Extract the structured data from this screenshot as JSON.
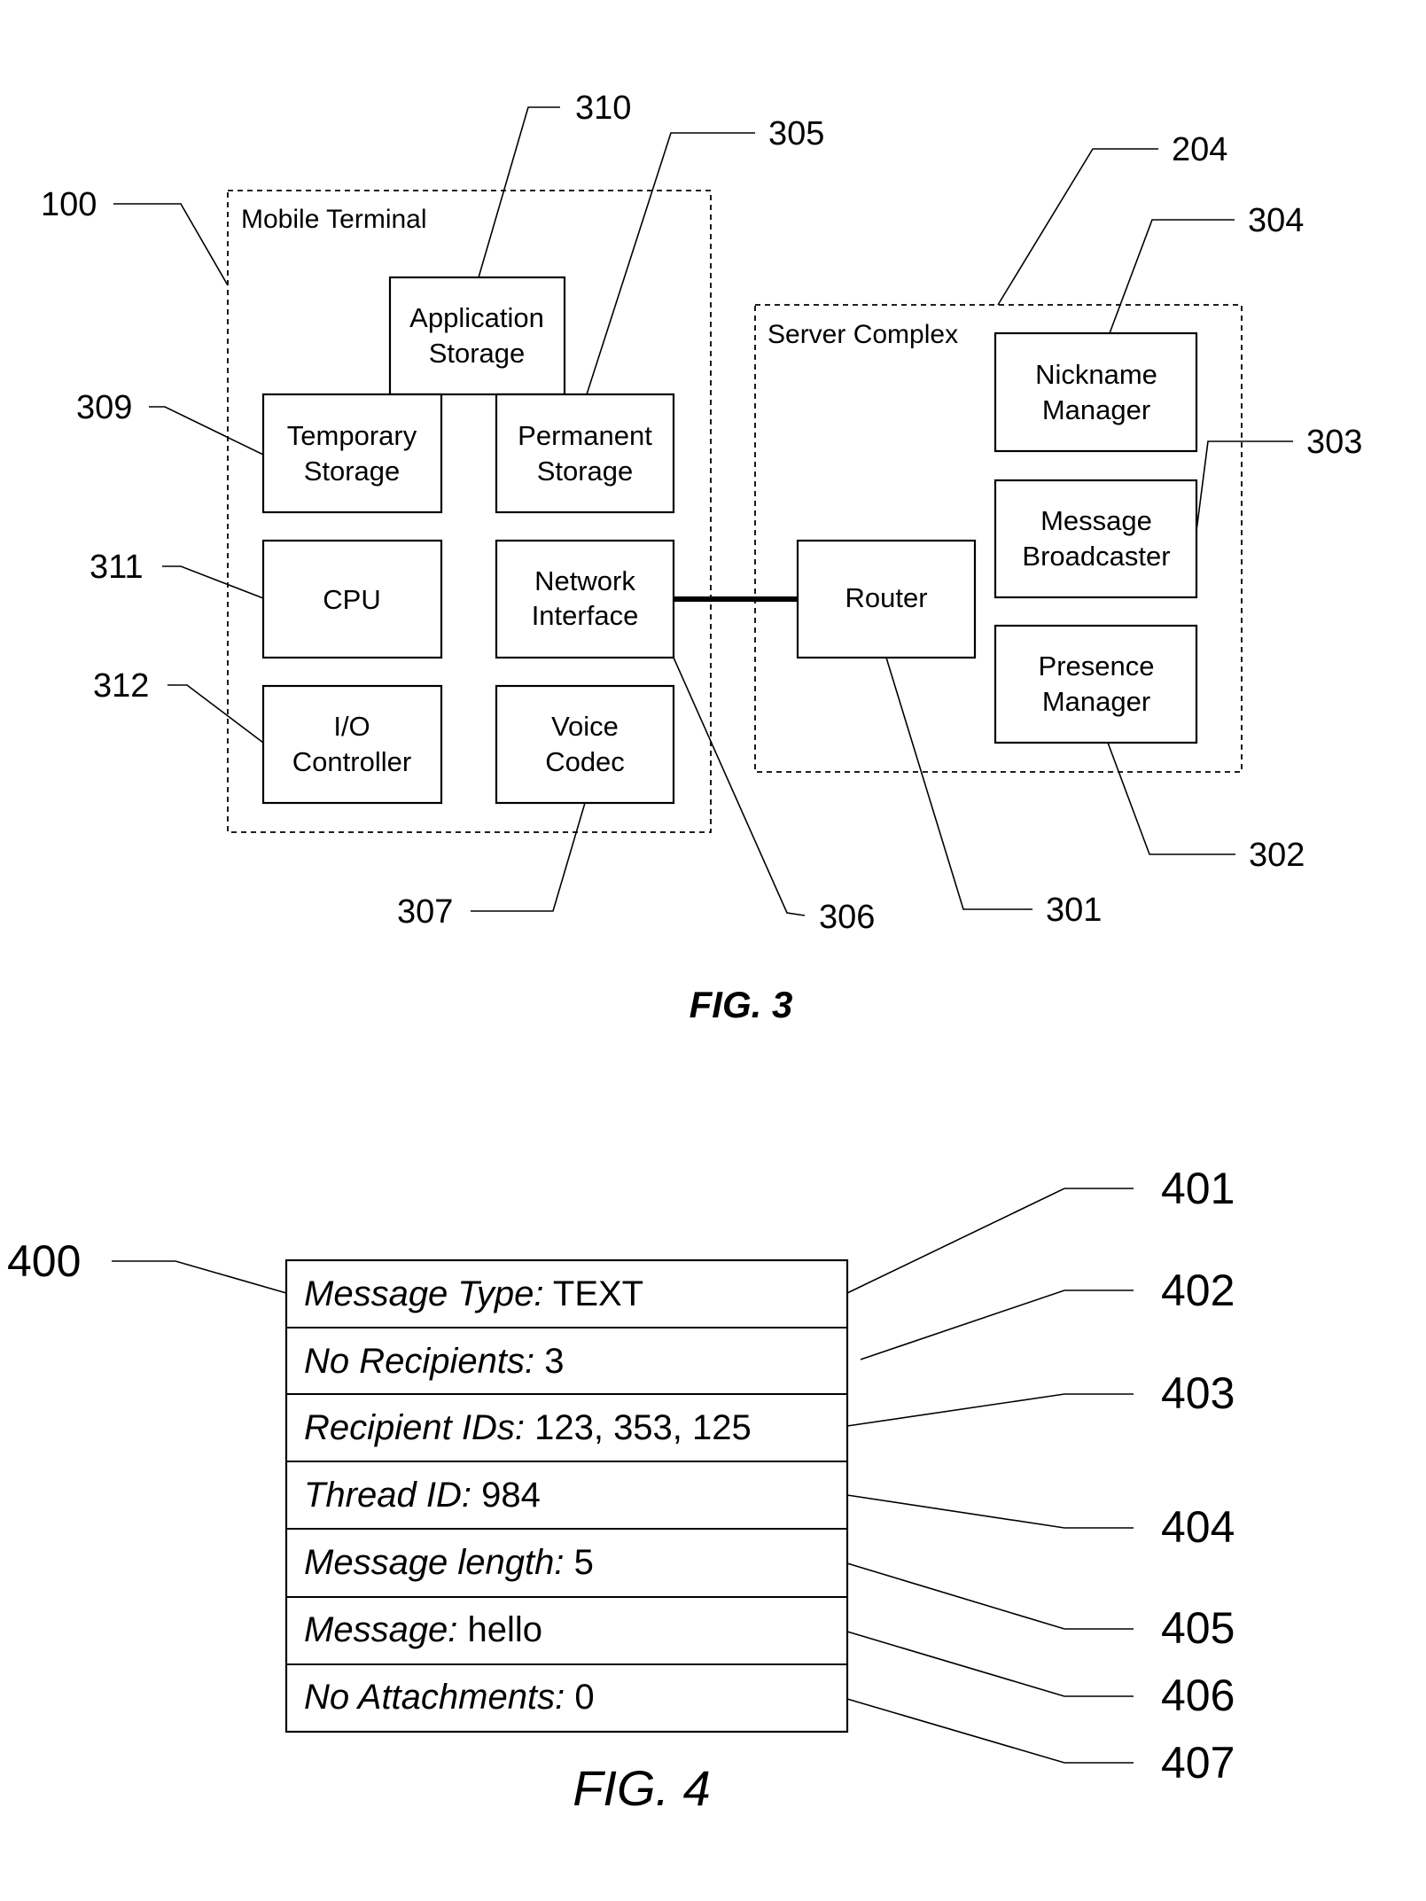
{
  "fig3": {
    "caption": "FIG. 3",
    "mobile_terminal": {
      "label": "Mobile Terminal",
      "ref": "100",
      "components": [
        {
          "id": "app-storage",
          "line1": "Application",
          "line2": "Storage",
          "ref": "310"
        },
        {
          "id": "temp-storage",
          "line1": "Temporary",
          "line2": "Storage",
          "ref": "309"
        },
        {
          "id": "perm-storage",
          "line1": "Permanent",
          "line2": "Storage",
          "ref": "305"
        },
        {
          "id": "cpu",
          "line1": "CPU",
          "line2": "",
          "ref": "311"
        },
        {
          "id": "network-interface",
          "line1": "Network",
          "line2": "Interface",
          "ref": "306"
        },
        {
          "id": "io-controller",
          "line1": "I/O",
          "line2": "Controller",
          "ref": "312"
        },
        {
          "id": "voice-codec",
          "line1": "Voice",
          "line2": "Codec",
          "ref": "307"
        }
      ]
    },
    "server_complex": {
      "label": "Server Complex",
      "ref": "204",
      "components": [
        {
          "id": "router",
          "line1": "Router",
          "line2": "",
          "ref": "301"
        },
        {
          "id": "nickname-manager",
          "line1": "Nickname",
          "line2": "Manager",
          "ref": "304"
        },
        {
          "id": "message-broadcaster",
          "line1": "Message",
          "line2": "Broadcaster",
          "ref": "303"
        },
        {
          "id": "presence-manager",
          "line1": "Presence",
          "line2": "Manager",
          "ref": "302"
        }
      ]
    }
  },
  "fig4": {
    "caption": "FIG. 4",
    "ref": "400",
    "rows": [
      {
        "key": "Message Type:",
        "value": " TEXT",
        "ref": "401"
      },
      {
        "key": "No Recipients:",
        "value": " 3",
        "ref": "402"
      },
      {
        "key": "Recipient IDs:",
        "value": " 123, 353, 125",
        "ref": "403"
      },
      {
        "key": "Thread ID:",
        "value": " 984",
        "ref": "404"
      },
      {
        "key": "Message length:",
        "value": " 5",
        "ref": "405"
      },
      {
        "key": "Message: ",
        "value": " hello",
        "ref": "406"
      },
      {
        "key": "No Attachments:",
        "value": " 0",
        "ref": "407"
      }
    ]
  }
}
